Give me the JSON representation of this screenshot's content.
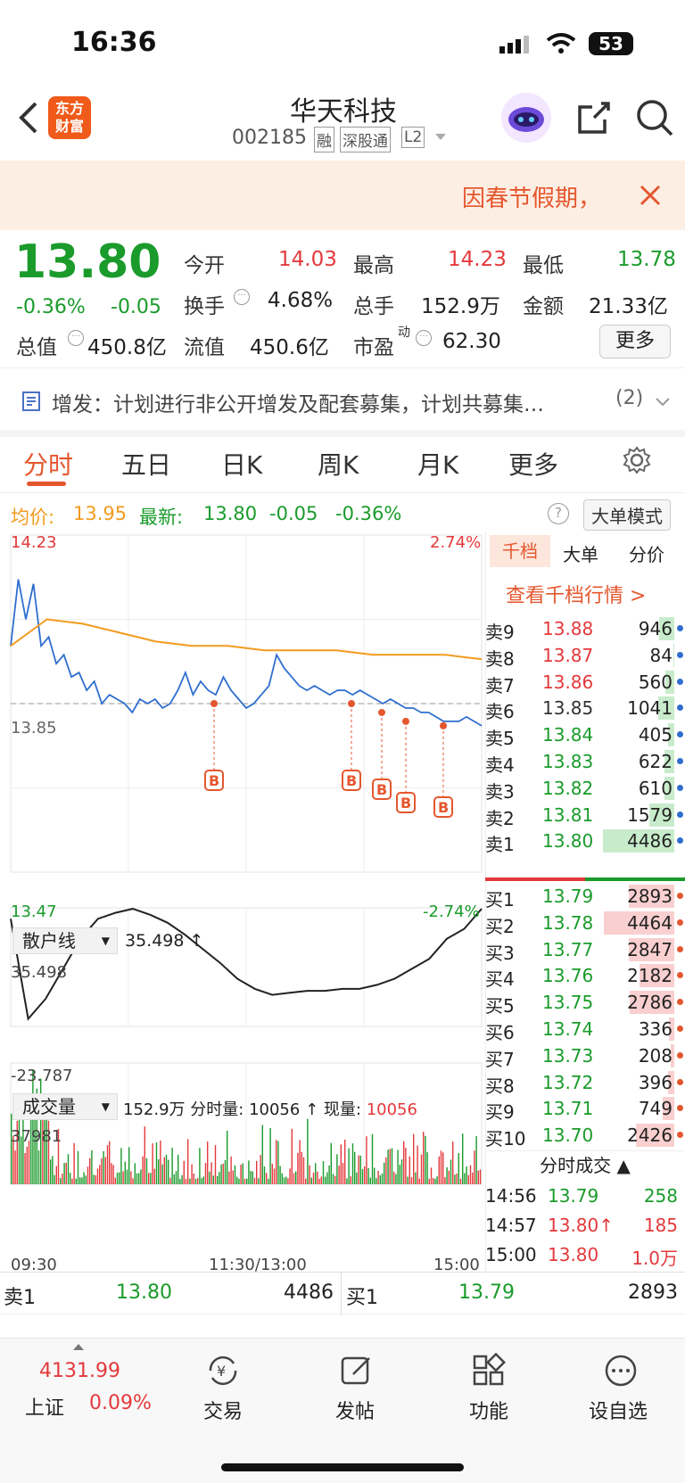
{
  "status": {
    "time": "16:36",
    "battery": "53"
  },
  "header": {
    "title": "华天科技",
    "code": "002185",
    "badges": [
      "融",
      "深股通",
      "L2"
    ],
    "logo": "东方\n财富"
  },
  "notice": {
    "text": "因春节假期，"
  },
  "quote": {
    "price": "13.80",
    "pct": "-0.36%",
    "chg": "-0.05",
    "open_l": "今开",
    "open": "14.03",
    "high_l": "最高",
    "high": "14.23",
    "low_l": "最低",
    "low": "13.78",
    "turn_l": "换手",
    "turn": "4.68%",
    "vol_l": "总手",
    "vol": "152.9万",
    "amt_l": "金额",
    "amt": "21.33亿",
    "mcap_l": "总值",
    "mcap": "450.8亿",
    "fcap_l": "流值",
    "fcap": "450.6亿",
    "pe_l": "市盈",
    "pe_sup": "动",
    "pe": "62.30",
    "more": "更多"
  },
  "announce": {
    "text": "增发：计划进行非公开增发及配套募集，计划共募集…",
    "count": "(2)"
  },
  "tabs": [
    "分时",
    "五日",
    "日K",
    "周K",
    "月K",
    "更多"
  ],
  "chart_info": {
    "avg_l": "均价:",
    "avg": "13.95",
    "last_l": "最新:",
    "last": "13.80",
    "chg": "-0.05",
    "pct": "-0.36%",
    "mode": "大单模式"
  },
  "chart_data": [
    {
      "type": "line",
      "title": "",
      "ylim": [
        13.47,
        14.23
      ],
      "y_ticks": [
        "14.23",
        "13.85",
        "13.47"
      ],
      "pct_ticks": [
        "2.74%",
        "-2.74%"
      ],
      "x_ticks": [
        "09:30",
        "11:30/13:00",
        "15:00"
      ],
      "series": [
        {
          "name": "",
          "values": [
            13.98,
            14.13,
            14.04,
            14.12,
            13.98,
            14.0,
            13.94,
            13.96,
            13.91,
            13.92,
            13.88,
            13.9,
            13.85,
            13.87,
            13.86,
            13.85,
            13.83,
            13.86,
            13.85,
            13.86,
            13.84,
            13.85,
            13.88,
            13.92,
            13.87,
            13.9,
            13.88,
            13.87,
            13.91,
            13.88,
            13.86,
            13.84,
            13.85,
            13.87,
            13.89,
            13.96,
            13.93,
            13.91,
            13.89,
            13.88,
            13.89,
            13.88,
            13.87,
            13.88,
            13.88,
            13.87,
            13.88,
            13.87,
            13.86,
            13.85,
            13.86,
            13.85,
            13.84,
            13.84,
            13.83,
            13.83,
            13.82,
            13.81,
            13.81,
            13.81,
            13.82,
            13.81,
            13.8
          ]
        },
        {
          "name": "均价",
          "values": [
            13.98,
            14.04,
            14.03,
            14.01,
            13.99,
            13.98,
            13.98,
            13.97,
            13.97,
            13.97,
            13.96,
            13.96,
            13.96,
            13.95
          ]
        }
      ]
    },
    {
      "type": "line",
      "title": "散户线",
      "value": "35.498",
      "ylim": [
        -23.787,
        35.498
      ],
      "y_ticks": [
        "35.498",
        "-23.787"
      ],
      "series": [
        {
          "name": "散户线",
          "values": [
            30,
            -20,
            -10,
            5,
            20,
            30,
            33,
            35,
            32,
            28,
            22,
            15,
            8,
            0,
            -5,
            -8,
            -7,
            -6,
            -6,
            -5,
            -5,
            -3,
            0,
            5,
            10,
            20,
            25,
            35
          ]
        }
      ]
    },
    {
      "type": "bar",
      "title": "成交量",
      "summary": "152.9万",
      "fen_l": "分时量:",
      "fen": "10056",
      "now_l": "现量:",
      "now": "10056",
      "ymax": "37981"
    }
  ],
  "orderbook": {
    "tabs": [
      "千档",
      "大单",
      "分价"
    ],
    "link": "查看千档行情 >",
    "sells": [
      [
        "卖9",
        "13.88",
        "946"
      ],
      [
        "卖8",
        "13.87",
        "84"
      ],
      [
        "卖7",
        "13.86",
        "560"
      ],
      [
        "卖6",
        "13.85",
        "1041"
      ],
      [
        "卖5",
        "13.84",
        "405"
      ],
      [
        "卖4",
        "13.83",
        "622"
      ],
      [
        "卖3",
        "13.82",
        "610"
      ],
      [
        "卖2",
        "13.81",
        "1579"
      ],
      [
        "卖1",
        "13.80",
        "4486"
      ]
    ],
    "buys": [
      [
        "买1",
        "13.79",
        "2893"
      ],
      [
        "买2",
        "13.78",
        "4464"
      ],
      [
        "买3",
        "13.77",
        "2847"
      ],
      [
        "买4",
        "13.76",
        "2182"
      ],
      [
        "买5",
        "13.75",
        "2786"
      ],
      [
        "买6",
        "13.74",
        "336"
      ],
      [
        "买7",
        "13.73",
        "208"
      ],
      [
        "买8",
        "13.72",
        "396"
      ],
      [
        "买9",
        "13.71",
        "749"
      ],
      [
        "买10",
        "13.70",
        "2426"
      ]
    ],
    "ticks_title": "分时成交",
    "ticks": [
      [
        "14:56",
        "13.79",
        "258"
      ],
      [
        "14:57",
        "13.80↑",
        "185"
      ],
      [
        "15:00",
        "13.80",
        "1.0万"
      ]
    ]
  },
  "bottom_row": {
    "s_l": "卖1",
    "s_p": "13.80",
    "s_v": "4486",
    "b_l": "买1",
    "b_p": "13.79",
    "b_v": "2893"
  },
  "bottom_nav": {
    "index_val": "4131.99",
    "index_name": "上证",
    "index_pct": "0.09%",
    "items": [
      "交易",
      "发帖",
      "功能",
      "设自选"
    ]
  }
}
